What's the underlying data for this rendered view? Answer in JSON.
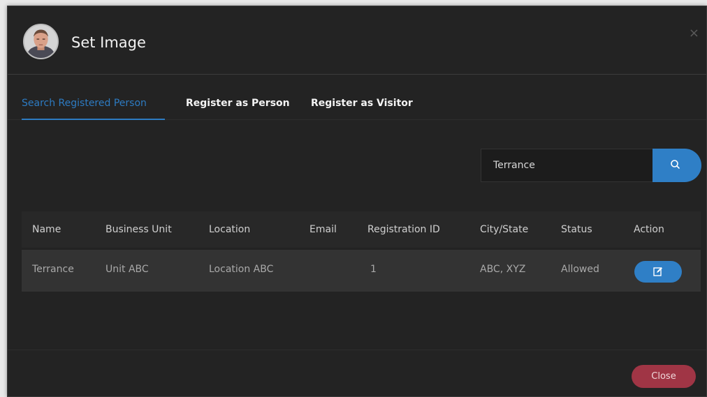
{
  "dialog": {
    "title": "Set Image",
    "close_symbol": "×"
  },
  "tabs": [
    {
      "label": "Search Registered Person",
      "active": true
    },
    {
      "label": "Register as Person",
      "active": false
    },
    {
      "label": "Register as Visitor",
      "active": false
    }
  ],
  "search": {
    "value": "Terrance",
    "icon": "search-icon"
  },
  "table": {
    "columns": [
      "Name",
      "Business Unit",
      "Location",
      "Email",
      "Registration ID",
      "City/State",
      "Status",
      "Action"
    ],
    "rows": [
      {
        "name": "Terrance",
        "business_unit": "Unit ABC",
        "location": "Location ABC",
        "email": "",
        "registration_id": "1",
        "city_state": "ABC, XYZ",
        "status": "Allowed",
        "action_icon": "edit-icon"
      }
    ]
  },
  "footer": {
    "close_label": "Close"
  },
  "colors": {
    "accent": "#2d7bc2",
    "danger": "#a03545",
    "background": "#232323"
  }
}
